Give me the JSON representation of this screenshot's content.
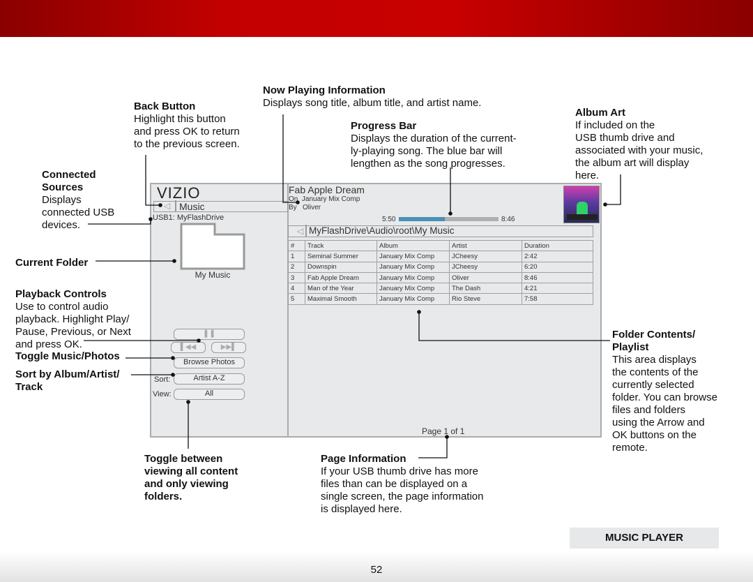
{
  "header": {
    "color": "#c30000"
  },
  "section_label": "MUSIC PLAYER",
  "page_number": "52",
  "callouts": {
    "back": {
      "title": "Back Button",
      "body": "Highlight this button\nand press OK to return\nto the previous screen."
    },
    "now_playing": {
      "title": "Now Playing Information",
      "body": "Displays song title, album title, and artist name."
    },
    "progress": {
      "title": "Progress Bar",
      "body": "Displays the duration of the current-\nly-playing song. The blue bar will\nlengthen as the song progresses."
    },
    "album_art": {
      "title": "Album Art",
      "body": "If included on the\nUSB thumb drive and\nassociated with your music,\nthe album art will display\nhere."
    },
    "sources": {
      "title": "Connected\nSources",
      "body": "Displays\nconnected USB\ndevices."
    },
    "folder": {
      "title": "Current Folder"
    },
    "playback": {
      "title": "Playback Controls",
      "body": "Use to control audio\nplayback. Highlight Play/\nPause, Previous, or Next\nand press OK."
    },
    "toggle_photos": {
      "title": "Toggle Music/Photos"
    },
    "sort": {
      "title": "Sort by Album/Artist/\nTrack"
    },
    "contents": {
      "title": "Folder Contents/\nPlaylist",
      "body": "This area displays\nthe contents of the\ncurrently selected\nfolder. You can browse\nfiles and folders\nusing the Arrow and\nOK buttons on the\nremote."
    },
    "view": {
      "title": "Toggle between\nviewing all content\nand only viewing\nfolders."
    },
    "page_info": {
      "title": "Page Information",
      "body": "If your USB thumb drive has more\nfiles than can be displayed on a\nsingle screen, the page information\nis displayed here."
    }
  },
  "tv": {
    "logo": "VIZIO",
    "back_label": "Music",
    "source": "USB1: MyFlashDrive",
    "folder_name": "My Music",
    "song_title": "Fab Apple Dream",
    "on_label": "On",
    "album": "January Mix Comp",
    "by_label": "By",
    "artist": "Oliver",
    "elapsed": "5:50",
    "total": "8:46",
    "progress_fraction": 0.46,
    "progress_color": "#4a90b8",
    "path": "MyFlashDrive\\Audio\\root\\My Music",
    "columns": [
      "#",
      "Track",
      "Album",
      "Artist",
      "Duration"
    ],
    "rows": [
      [
        "1",
        "Seminal Summer",
        "January Mix Comp",
        "JCheesy",
        "2:42"
      ],
      [
        "2",
        "Downspin",
        "January Mix Comp",
        "JCheesy",
        "6:20"
      ],
      [
        "3",
        "Fab Apple Dream",
        "January Mix Comp",
        "Oliver",
        "8:46"
      ],
      [
        "4",
        "Man of the Year",
        "January Mix Comp",
        "The Dash",
        "4:21"
      ],
      [
        "5",
        "Maximal Smooth",
        "January Mix Comp",
        "Rio Steve",
        "7:58"
      ]
    ],
    "page": "Page 1 of 1",
    "browse_photos": "Browse Photos",
    "sort_label": "Sort:",
    "sort_value": "Artist A-Z",
    "view_label": "View:",
    "view_value": "All"
  }
}
